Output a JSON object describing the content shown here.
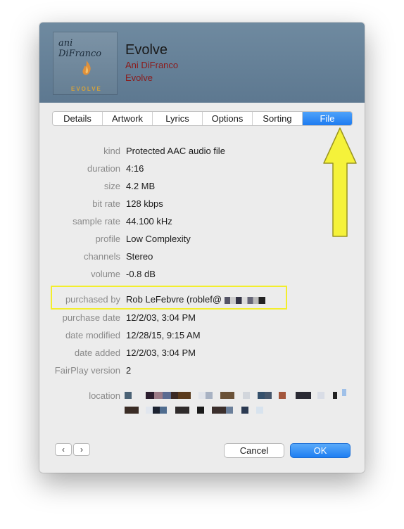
{
  "header": {
    "artwork_text": "ani DiFranco",
    "artwork_word": "EVOLVE",
    "title": "Evolve",
    "artist": "Ani DiFranco",
    "album": "Evolve"
  },
  "tabs": [
    {
      "label": "Details",
      "active": false
    },
    {
      "label": "Artwork",
      "active": false
    },
    {
      "label": "Lyrics",
      "active": false
    },
    {
      "label": "Options",
      "active": false
    },
    {
      "label": "Sorting",
      "active": false
    },
    {
      "label": "File",
      "active": true
    }
  ],
  "fields": [
    {
      "label": "kind",
      "value": "Protected AAC audio file"
    },
    {
      "label": "duration",
      "value": "4:16"
    },
    {
      "label": "size",
      "value": "4.2 MB"
    },
    {
      "label": "bit rate",
      "value": "128 kbps"
    },
    {
      "label": "sample rate",
      "value": "44.100 kHz"
    },
    {
      "label": "profile",
      "value": "Low Complexity"
    },
    {
      "label": "channels",
      "value": "Stereo"
    },
    {
      "label": "volume",
      "value": "-0.8 dB"
    },
    {
      "label": "purchased by",
      "value": "Rob LeFebvre (roblef@"
    },
    {
      "label": "purchase date",
      "value": "12/2/03, 3:04 PM"
    },
    {
      "label": "date modified",
      "value": "12/28/15, 9:15 AM"
    },
    {
      "label": "date added",
      "value": "12/2/03, 3:04 PM"
    },
    {
      "label": "FairPlay version",
      "value": "2"
    }
  ],
  "location_label": "location",
  "buttons": {
    "prev": "‹",
    "next": "›",
    "cancel": "Cancel",
    "ok": "OK"
  },
  "colors": {
    "accent": "#1d7bf0",
    "annotation": "#f3ee2c",
    "header_bg": "#6a859b",
    "artist_text": "#8b1b1b"
  }
}
